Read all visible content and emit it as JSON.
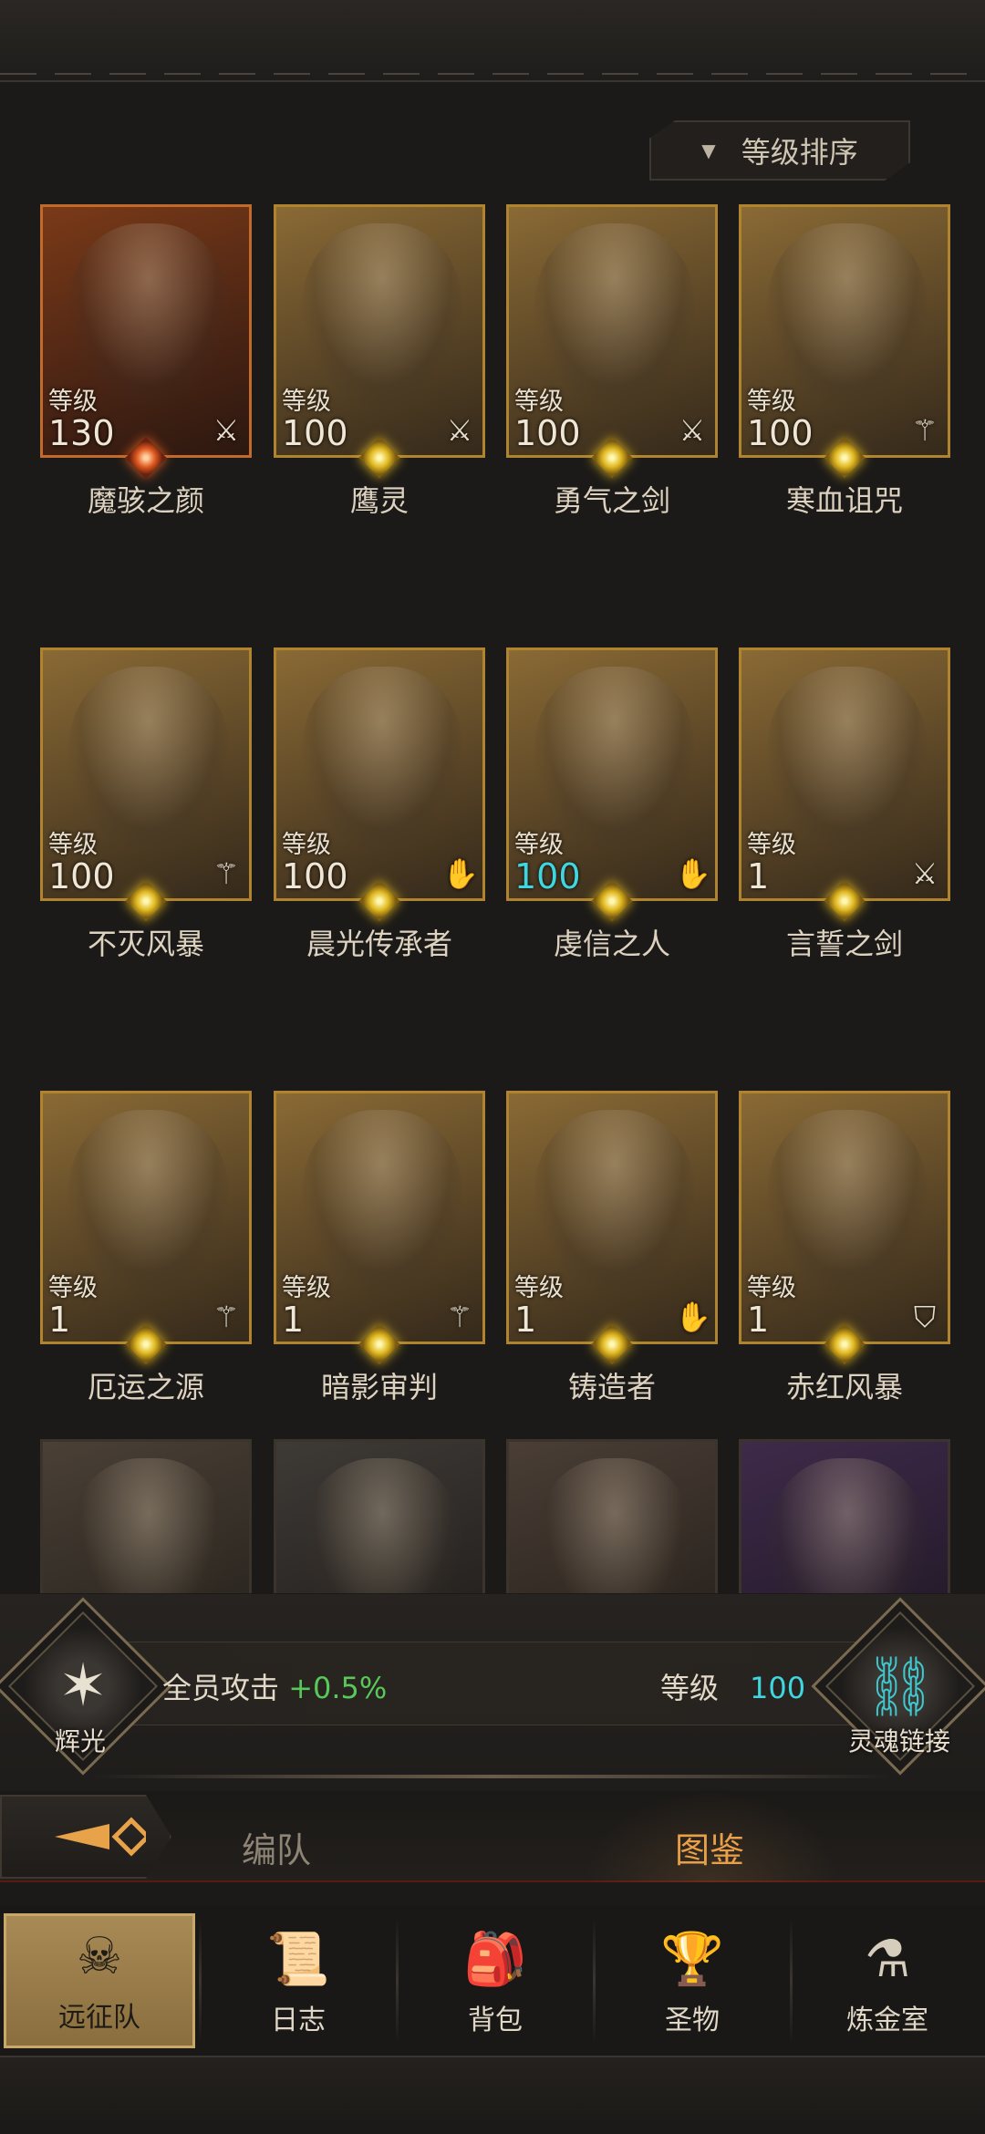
{
  "sort": {
    "label": "等级排序"
  },
  "heroes": [
    {
      "name": "魔骇之颜",
      "level_label": "等级",
      "level": "130",
      "class_icon": "sword-icon",
      "variant": "red",
      "gem": "star"
    },
    {
      "name": "鹰灵",
      "level_label": "等级",
      "level": "100",
      "class_icon": "sword-icon",
      "variant": "gold",
      "gem": "diamond"
    },
    {
      "name": "勇气之剑",
      "level_label": "等级",
      "level": "100",
      "class_icon": "sword-icon",
      "variant": "gold",
      "gem": "diamond"
    },
    {
      "name": "寒血诅咒",
      "level_label": "等级",
      "level": "100",
      "class_icon": "staff-icon",
      "variant": "gold",
      "gem": "diamond"
    },
    {
      "name": "不灭风暴",
      "level_label": "等级",
      "level": "100",
      "class_icon": "staff-icon",
      "variant": "gold",
      "gem": "diamond"
    },
    {
      "name": "晨光传承者",
      "level_label": "等级",
      "level": "100",
      "class_icon": "palm-icon",
      "variant": "gold",
      "gem": "diamond"
    },
    {
      "name": "虔信之人",
      "level_label": "等级",
      "level": "100",
      "class_icon": "palm-icon",
      "variant": "gold",
      "gem": "diamond",
      "level_color": "cyan"
    },
    {
      "name": "言誓之剑",
      "level_label": "等级",
      "level": "1",
      "class_icon": "sword-icon",
      "variant": "gold",
      "gem": "diamond"
    },
    {
      "name": "厄运之源",
      "level_label": "等级",
      "level": "1",
      "class_icon": "staff-icon",
      "variant": "gold",
      "gem": "diamond"
    },
    {
      "name": "暗影审判",
      "level_label": "等级",
      "level": "1",
      "class_icon": "staff-icon",
      "variant": "gold",
      "gem": "diamond"
    },
    {
      "name": "铸造者",
      "level_label": "等级",
      "level": "1",
      "class_icon": "palm-icon",
      "variant": "gold",
      "gem": "diamond"
    },
    {
      "name": "赤红风暴",
      "level_label": "等级",
      "level": "1",
      "class_icon": "shield-icon",
      "variant": "gold",
      "gem": "diamond"
    }
  ],
  "buff": {
    "emblem_caption": "辉光",
    "label": "全员攻击",
    "value": "+0.5%",
    "level_label": "等级",
    "level_value": "100",
    "link_caption": "灵魂链接"
  },
  "tabs": {
    "formation": "编队",
    "codex": "图鉴",
    "active": "codex"
  },
  "nav": [
    {
      "label": "远征队",
      "icon": "horned-skull-icon",
      "active": true
    },
    {
      "label": "日志",
      "icon": "scroll-icon",
      "active": false
    },
    {
      "label": "背包",
      "icon": "backpack-icon",
      "active": false
    },
    {
      "label": "圣物",
      "icon": "chalice-icon",
      "active": false
    },
    {
      "label": "炼金室",
      "icon": "alchemy-icon",
      "active": false
    }
  ],
  "colors": {
    "accent_gold": "#b0832f",
    "level_cyan": "#3fd6e0",
    "buff_green": "#59c85a",
    "tab_active": "#e8a04a"
  }
}
